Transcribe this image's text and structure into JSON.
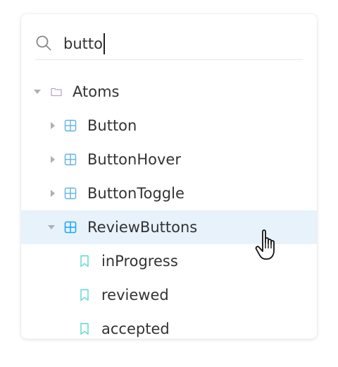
{
  "search": {
    "query": "butto",
    "icon": "search-icon"
  },
  "tree": {
    "group": {
      "label": "Atoms",
      "icon": "folder-icon",
      "expanded": true
    },
    "components": [
      {
        "label": "Button",
        "icon": "component-icon",
        "expanded": false
      },
      {
        "label": "ButtonHover",
        "icon": "component-icon",
        "expanded": false
      },
      {
        "label": "ButtonToggle",
        "icon": "component-icon",
        "expanded": false
      },
      {
        "label": "ReviewButtons",
        "icon": "component-icon",
        "expanded": true,
        "selected": true
      }
    ],
    "stories": [
      {
        "label": "inProgress",
        "icon": "bookmark-icon"
      },
      {
        "label": "reviewed",
        "icon": "bookmark-icon"
      },
      {
        "label": "accepted",
        "icon": "bookmark-icon"
      }
    ]
  },
  "colors": {
    "selected_background": "#e8f2fb",
    "folder_icon": "#b6a4d9",
    "component_icon": "#5fb2e8",
    "component_icon_selected": "#1ea7fd",
    "story_icon": "#5ad6d4",
    "arrow": "#a9b0b8",
    "text": "#333333"
  }
}
